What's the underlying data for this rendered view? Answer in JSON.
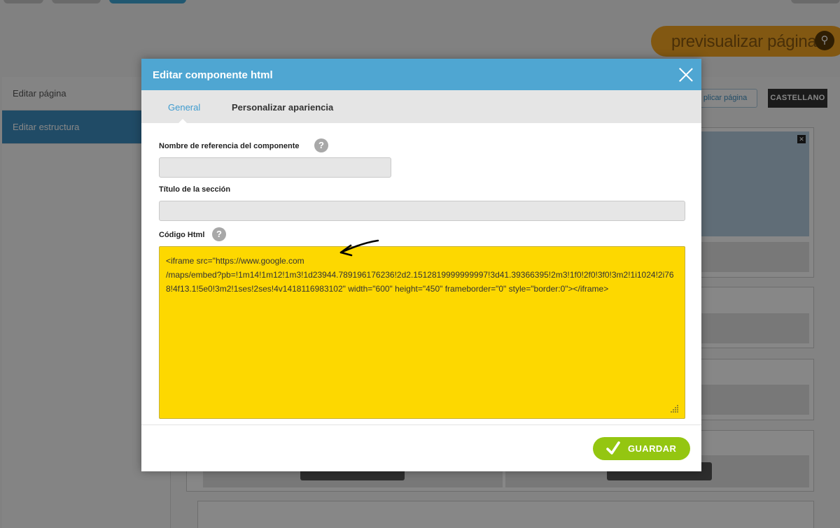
{
  "background": {
    "preview_button": "previsualizar página",
    "sidebar": [
      {
        "label": "Editar página"
      },
      {
        "label": "Editar estructura"
      }
    ],
    "apply_button": "plicar página",
    "language_button": "CASTELLANO"
  },
  "modal": {
    "title": "Editar componente html",
    "tabs": [
      {
        "label": "General",
        "active": true
      },
      {
        "label": "Personalizar apariencia",
        "active": false
      }
    ],
    "fields": {
      "reference_name": {
        "label": "Nombre de referencia del componente",
        "value": ""
      },
      "section_title": {
        "label": "Título de la sección",
        "value": ""
      },
      "html_code": {
        "label": "Código Html",
        "value": "<iframe src=\"https://www.google.com\n/maps/embed?pb=!1m14!1m12!1m3!1d23944.789196176236!2d2.1512819999999997!3d41.39366395!2m3!1f0!2f0!3f0!3m2!1i1024!2i768!4f13.1!5e0!3m2!1ses!2ses!4v1418116983102\" width=\"600\" height=\"450\" frameborder=\"0\" style=\"border:0\"></iframe>"
      }
    },
    "help_icon": "?",
    "save_button": "GUARDAR"
  },
  "colors": {
    "header_blue": "#4fa6d2",
    "code_bg": "#fdd800",
    "save_green": "#94c611",
    "preview_orange": "#f5a623"
  },
  "icons": [
    "close-icon",
    "help-icon",
    "check-icon",
    "search-icon",
    "resize-grip-icon",
    "arrow-annotation"
  ]
}
